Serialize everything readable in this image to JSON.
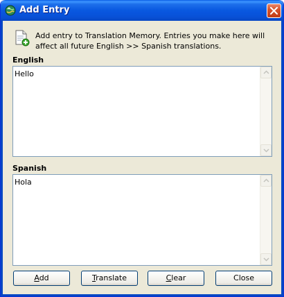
{
  "window": {
    "title": "Add Entry",
    "accent": "#0851D8",
    "face": "#ECE9D8"
  },
  "icons": {
    "title_icon": "app-globe-icon",
    "info_icon": "add-document-icon",
    "close_icon": "close-icon"
  },
  "info": {
    "text": "Add entry to Translation Memory. Entries you make here will affect all future English >> Spanish translations."
  },
  "english": {
    "label": "English",
    "value": "Hello"
  },
  "spanish": {
    "label": "Spanish",
    "value": "Hola"
  },
  "buttons": {
    "add": {
      "mnemonic": "A",
      "rest": "dd"
    },
    "translate": {
      "mnemonic": "T",
      "rest": "ranslate"
    },
    "clear": {
      "mnemonic": "C",
      "rest": "lear"
    },
    "close": {
      "label": "Close"
    }
  }
}
